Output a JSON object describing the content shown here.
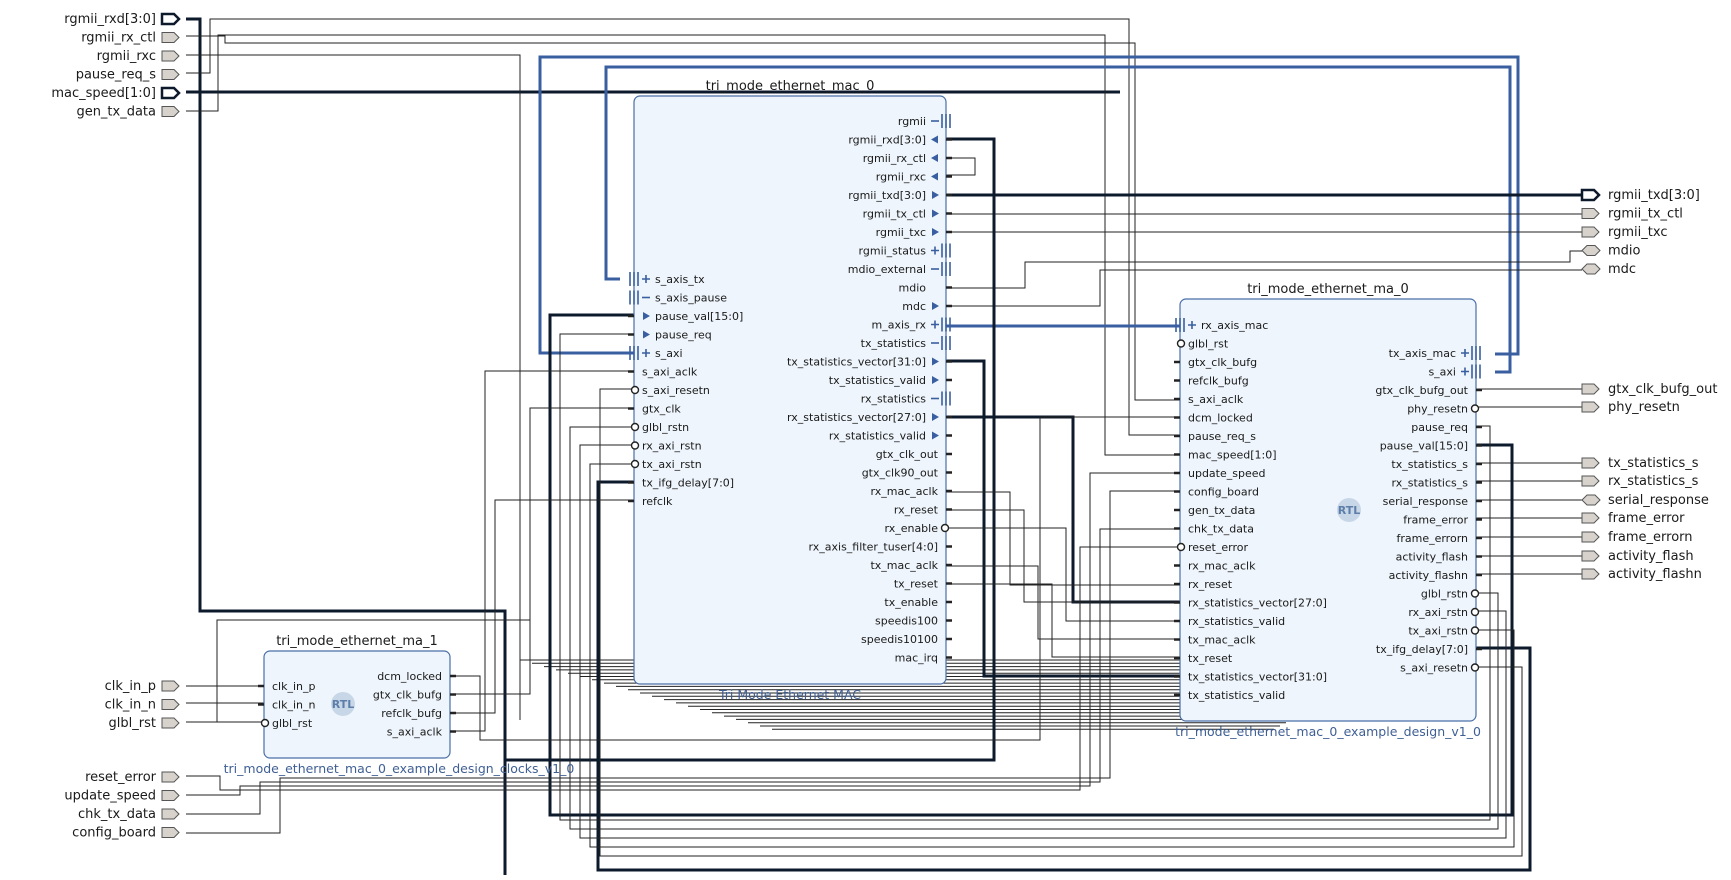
{
  "external_inputs_top": [
    "rgmii_rxd[3:0]",
    "rgmii_rx_ctl",
    "rgmii_rxc",
    "pause_req_s",
    "mac_speed[1:0]",
    "gen_tx_data"
  ],
  "external_inputs_clk": [
    "clk_in_p",
    "clk_in_n",
    "glbl_rst"
  ],
  "external_inputs_bottom": [
    "reset_error",
    "update_speed",
    "chk_tx_data",
    "config_board"
  ],
  "external_outputs_top": [
    "rgmii_txd[3:0]",
    "rgmii_tx_ctl",
    "rgmii_txc",
    "mdio",
    "mdc"
  ],
  "external_outputs_right": [
    "gtx_clk_bufg_out",
    "phy_resetn",
    "tx_statistics_s",
    "rx_statistics_s",
    "serial_response",
    "frame_error",
    "frame_errorn",
    "activity_flash",
    "activity_flashn"
  ],
  "mac_block": {
    "title": "tri_mode_ethernet_mac_0",
    "subtitle": "Tri Mode Ethernet MAC",
    "left_pins": [
      "s_axis_tx",
      "s_axis_pause",
      "pause_val[15:0]",
      "pause_req",
      "s_axi",
      "s_axi_aclk",
      "s_axi_resetn",
      "gtx_clk",
      "glbl_rstn",
      "rx_axi_rstn",
      "tx_axi_rstn",
      "tx_ifg_delay[7:0]",
      "refclk"
    ],
    "right_pins": [
      "rgmii",
      "rgmii_rxd[3:0]",
      "rgmii_rx_ctl",
      "rgmii_rxc",
      "rgmii_txd[3:0]",
      "rgmii_tx_ctl",
      "rgmii_txc",
      "rgmii_status",
      "mdio_external",
      "mdio",
      "mdc",
      "m_axis_rx",
      "tx_statistics",
      "tx_statistics_vector[31:0]",
      "tx_statistics_valid",
      "rx_statistics",
      "rx_statistics_vector[27:0]",
      "rx_statistics_valid",
      "gtx_clk_out",
      "gtx_clk90_out",
      "rx_mac_aclk",
      "rx_reset",
      "rx_enable",
      "rx_axis_filter_tuser[4:0]",
      "tx_mac_aclk",
      "tx_reset",
      "tx_enable",
      "speedis100",
      "speedis10100",
      "mac_irq"
    ]
  },
  "example_block": {
    "title": "tri_mode_ethernet_ma_0",
    "subtitle": "tri_mode_ethernet_mac_0_example_design_v1_0",
    "badge": "RTL",
    "left_pins": [
      "rx_axis_mac",
      "glbl_rst",
      "gtx_clk_bufg",
      "refclk_bufg",
      "s_axi_aclk",
      "dcm_locked",
      "pause_req_s",
      "mac_speed[1:0]",
      "update_speed",
      "config_board",
      "gen_tx_data",
      "chk_tx_data",
      "reset_error",
      "rx_mac_aclk",
      "rx_reset",
      "rx_statistics_vector[27:0]",
      "rx_statistics_valid",
      "tx_mac_aclk",
      "tx_reset",
      "tx_statistics_vector[31:0]",
      "tx_statistics_valid"
    ],
    "right_pins": [
      "tx_axis_mac",
      "s_axi",
      "gtx_clk_bufg_out",
      "phy_resetn",
      "pause_req",
      "pause_val[15:0]",
      "tx_statistics_s",
      "rx_statistics_s",
      "serial_response",
      "frame_error",
      "frame_errorn",
      "activity_flash",
      "activity_flashn",
      "glbl_rstn",
      "rx_axi_rstn",
      "tx_axi_rstn",
      "tx_ifg_delay[7:0]",
      "s_axi_resetn"
    ]
  },
  "clocks_block": {
    "title": "tri_mode_ethernet_ma_1",
    "subtitle": "tri_mode_ethernet_mac_0_example_design_clocks_v1_0",
    "badge": "RTL",
    "left_pins": [
      "clk_in_p",
      "clk_in_n",
      "glbl_rst"
    ],
    "right_pins": [
      "dcm_locked",
      "gtx_clk_bufg",
      "refclk_bufg",
      "s_axi_aclk"
    ]
  },
  "colors": {
    "block_fill": "#eef5fc",
    "block_border": "#4a6fa8",
    "interface_wire": "#3a5fa0",
    "bus_wire": "#0d1a2b",
    "port_fill": "#d8d2cc"
  }
}
